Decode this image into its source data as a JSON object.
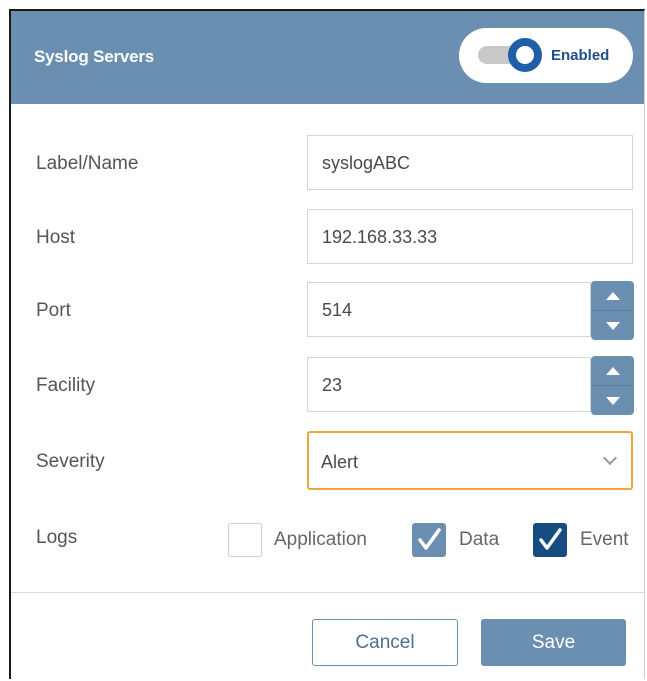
{
  "header": {
    "title": "Syslog Servers",
    "toggle": {
      "label": "Enabled",
      "state": "on"
    }
  },
  "form": {
    "label_name": {
      "label": "Label/Name",
      "value": "syslogABC"
    },
    "host": {
      "label": "Host",
      "value": "192.168.33.33"
    },
    "port": {
      "label": "Port",
      "value": "514"
    },
    "facility": {
      "label": "Facility",
      "value": "23"
    },
    "severity": {
      "label": "Severity",
      "value": "Alert"
    },
    "logs": {
      "label": "Logs",
      "options": [
        {
          "label": "Application",
          "checked": false
        },
        {
          "label": "Data",
          "checked": true
        },
        {
          "label": "Event",
          "checked": true
        }
      ]
    }
  },
  "footer": {
    "cancel_label": "Cancel",
    "save_label": "Save"
  },
  "colors": {
    "header_bg": "#6b8fb0",
    "toggle_accent": "#1f5ea8",
    "select_focus": "#f0a63a",
    "checkbox_dark": "#174c80"
  }
}
